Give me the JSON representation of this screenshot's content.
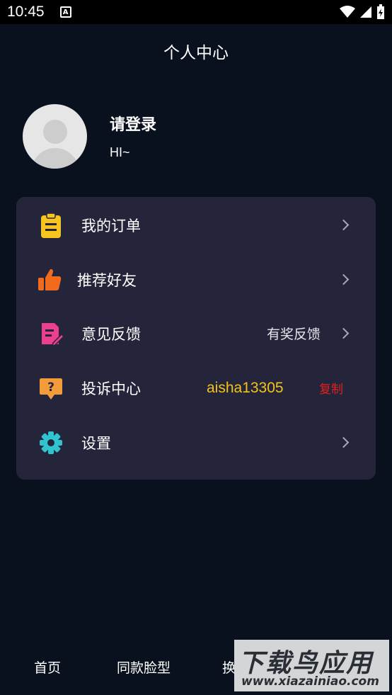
{
  "status_bar": {
    "time": "10:45",
    "notification_glyph": "A"
  },
  "header": {
    "title": "个人中心"
  },
  "profile": {
    "name": "请登录",
    "greeting": "HI~"
  },
  "menu": {
    "items": [
      {
        "label": "我的订单",
        "icon": "clipboard-icon",
        "color": "#f7c51d"
      },
      {
        "label": "推荐好友",
        "icon": "thumbs-up-icon",
        "color": "#f26a1b"
      },
      {
        "label": "意见反馈",
        "icon": "feedback-edit-icon",
        "color": "#ec3f8f",
        "extra": "有奖反馈"
      },
      {
        "label": "投诉中心",
        "icon": "question-bubble-icon",
        "color": "#f39b3a",
        "user_id": "aisha13305",
        "copy": "复制"
      },
      {
        "label": "设置",
        "icon": "gear-icon",
        "color": "#2fc4cf"
      }
    ]
  },
  "tabbar": {
    "tabs": [
      "首页",
      "同款脸型",
      "换"
    ]
  },
  "watermark": {
    "line1": "下载鸟应用",
    "line2": "www.xiazainiao.com"
  }
}
